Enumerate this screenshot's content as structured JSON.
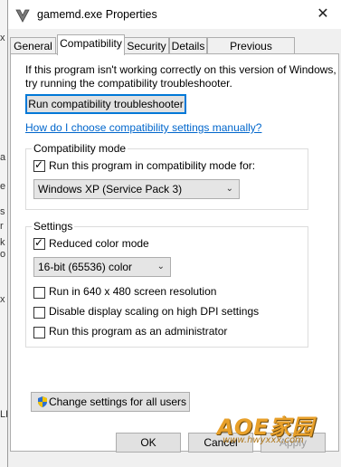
{
  "background": {
    "edge_letters": [
      "x",
      "a",
      "e",
      "s",
      "r",
      "k",
      "o",
      "x",
      "LL"
    ]
  },
  "window": {
    "title": "gamemd.exe Properties",
    "close_label": "✕"
  },
  "tabs": [
    {
      "label": "General",
      "active": false
    },
    {
      "label": "Compatibility",
      "active": true
    },
    {
      "label": "Security",
      "active": false
    },
    {
      "label": "Details",
      "active": false
    },
    {
      "label": "Previous Versions",
      "active": false
    }
  ],
  "compat": {
    "intro_text_line1": "If this program isn't working correctly on this version of Windows,",
    "intro_text_line2": "try running the compatibility troubleshooter.",
    "troubleshooter_button": "Run compatibility troubleshooter",
    "manual_link": "How do I choose compatibility settings manually?",
    "mode_group_title": "Compatibility mode",
    "mode_checkbox_label": "Run this program in compatibility mode for:",
    "mode_checked": true,
    "mode_selected": "Windows XP (Service Pack 3)",
    "settings_group_title": "Settings",
    "reduced_color_label": "Reduced color mode",
    "reduced_color_checked": true,
    "color_selected": "16-bit (65536) color",
    "res_640_label": "Run in 640 x 480 screen resolution",
    "res_640_checked": false,
    "dpi_label": "Disable display scaling on high DPI settings",
    "dpi_checked": false,
    "admin_label": "Run this program as an administrator",
    "admin_checked": false,
    "all_users_button": "Change settings for all users"
  },
  "footer": {
    "ok": "OK",
    "cancel": "Cancel",
    "apply": "Apply"
  },
  "watermark": {
    "title": "AOE家园",
    "url": "www.hwyxxx.com"
  },
  "colors": {
    "accent": "#0078d7",
    "link": "#0066cc",
    "watermark": "#e8a02a"
  }
}
